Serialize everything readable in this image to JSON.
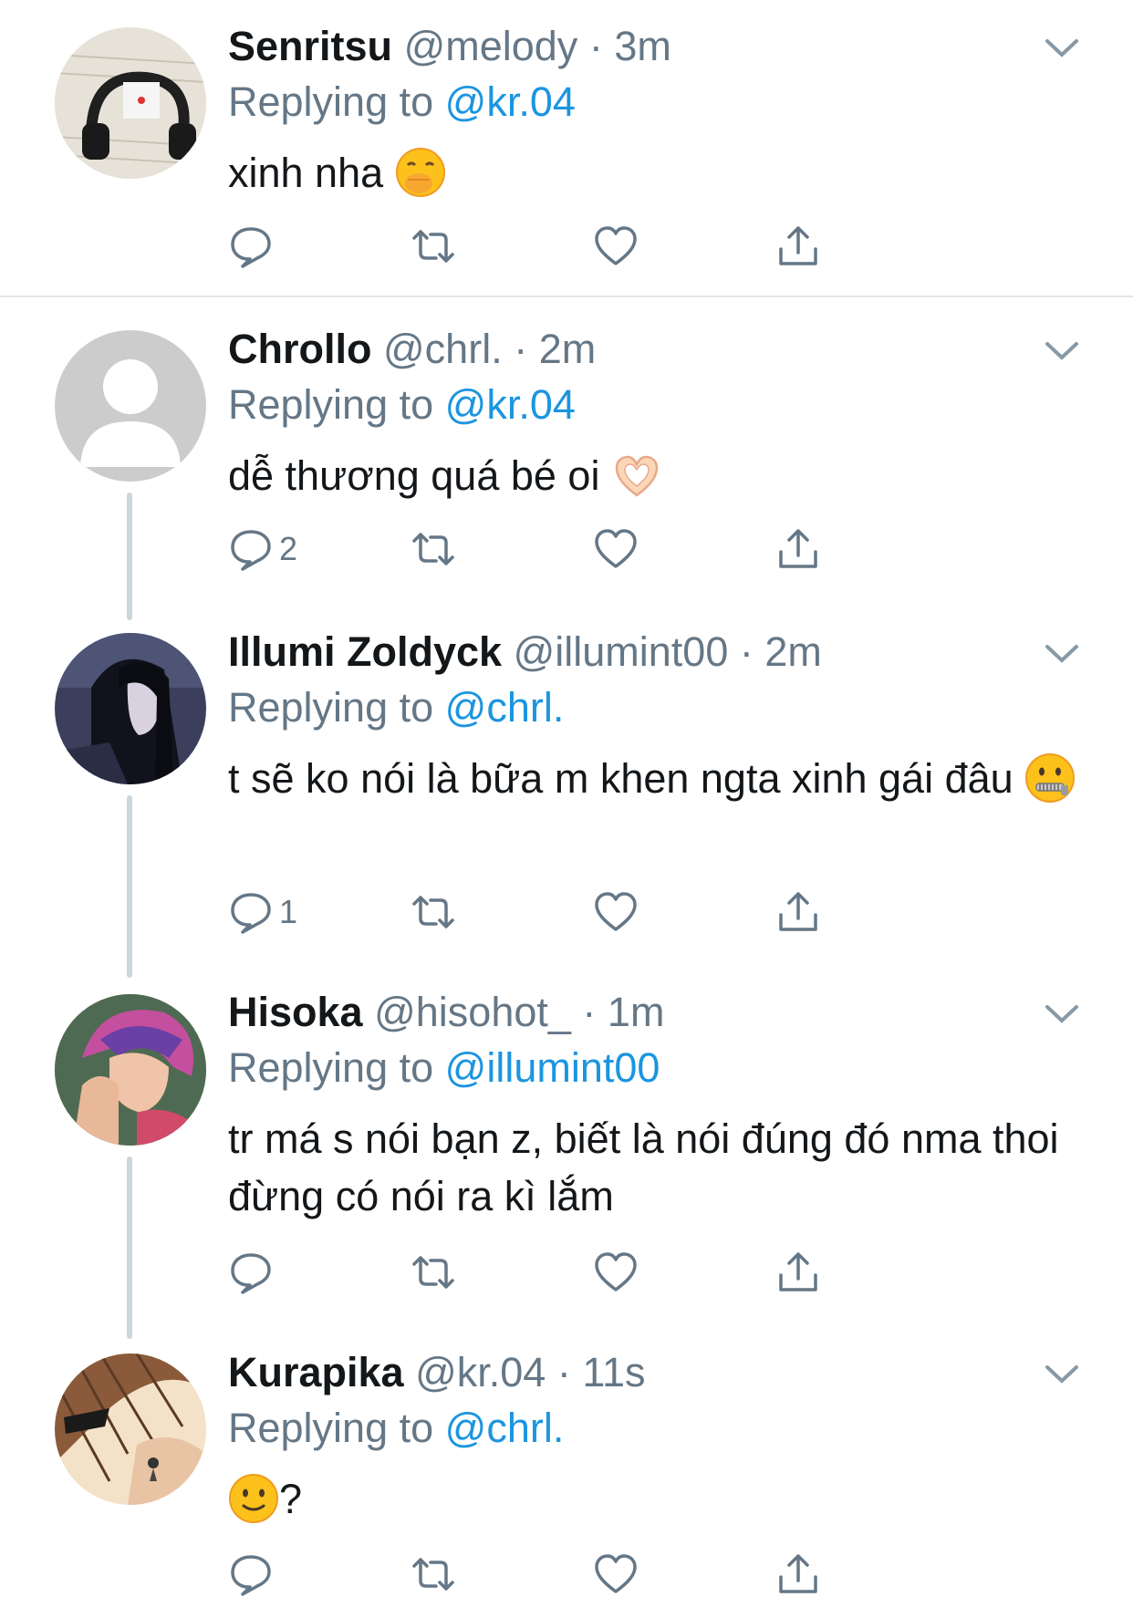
{
  "replying_prefix": "Replying to",
  "colors": {
    "link": "#1b95e0",
    "muted": "#657786",
    "thread_line": "#ccd6dd"
  },
  "tweets": [
    {
      "name": "Senritsu",
      "handle": "@melody",
      "time": "3m",
      "replying_to": "@kr.04",
      "text": "xinh nha",
      "emoji": "face-with-hand-over-mouth",
      "reply_count": "",
      "avatar_icon": "headphones-avatar"
    },
    {
      "name": "Chrollo",
      "handle": "@chrl.",
      "time": "2m",
      "replying_to": "@kr.04",
      "text": "dễ thương quá bé oi",
      "emoji": "heart-hands",
      "reply_count": "2",
      "avatar_icon": "default-avatar"
    },
    {
      "name": "Illumi Zoldyck",
      "handle": "@illumint00",
      "time": "2m",
      "replying_to": "@chrl.",
      "text": "t sẽ ko nói là bữa m khen ngta xinh gái đâu",
      "emoji": "zipper-mouth-face",
      "reply_count": "1",
      "avatar_icon": "anime-dark-hair-avatar"
    },
    {
      "name": "Hisoka",
      "handle": "@hisohot_",
      "time": "1m",
      "replying_to": "@illumint00",
      "text": "tr má s nói bạn z, biết là nói đúng đó nma thoi đừng có nói ra kì lắm",
      "emoji": "",
      "reply_count": "",
      "avatar_icon": "anime-pink-hair-avatar"
    },
    {
      "name": "Kurapika",
      "handle": "@kr.04",
      "time": "11s",
      "replying_to": "@chrl.",
      "text": "?",
      "emoji": "slightly-smiling-face",
      "reply_count": "",
      "avatar_icon": "anime-blond-hair-avatar"
    }
  ]
}
